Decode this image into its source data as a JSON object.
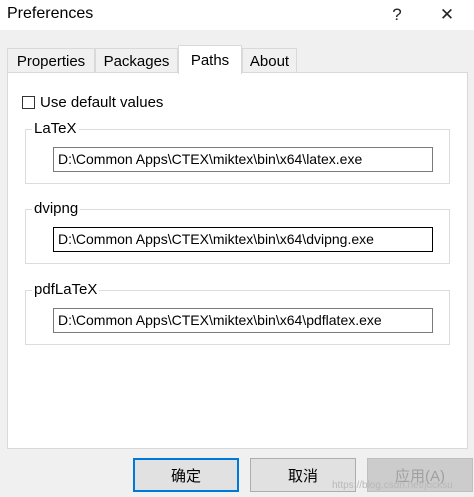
{
  "window": {
    "title": "Preferences",
    "help_label": "?",
    "close_label": "✕"
  },
  "tabs": [
    {
      "label": "Properties",
      "active": false
    },
    {
      "label": "Packages",
      "active": false
    },
    {
      "label": "Paths",
      "active": true
    },
    {
      "label": "About",
      "active": false
    }
  ],
  "use_default": {
    "label": "Use default values",
    "checked": false
  },
  "groups": {
    "latex": {
      "label": "LaTeX",
      "value": "D:\\Common Apps\\CTEX\\miktex\\bin\\x64\\latex.exe"
    },
    "dvipng": {
      "label": "dvipng",
      "value": "D:\\Common Apps\\CTEX\\miktex\\bin\\x64\\dvipng.exe"
    },
    "pdflatex": {
      "label": "pdfLaTeX",
      "value": "D:\\Common Apps\\CTEX\\miktex\\bin\\x64\\pdflatex.exe"
    }
  },
  "buttons": {
    "ok": "确定",
    "cancel": "取消",
    "apply": "应用(A)"
  },
  "watermark": "https://blog.csdn.net/jucksu"
}
